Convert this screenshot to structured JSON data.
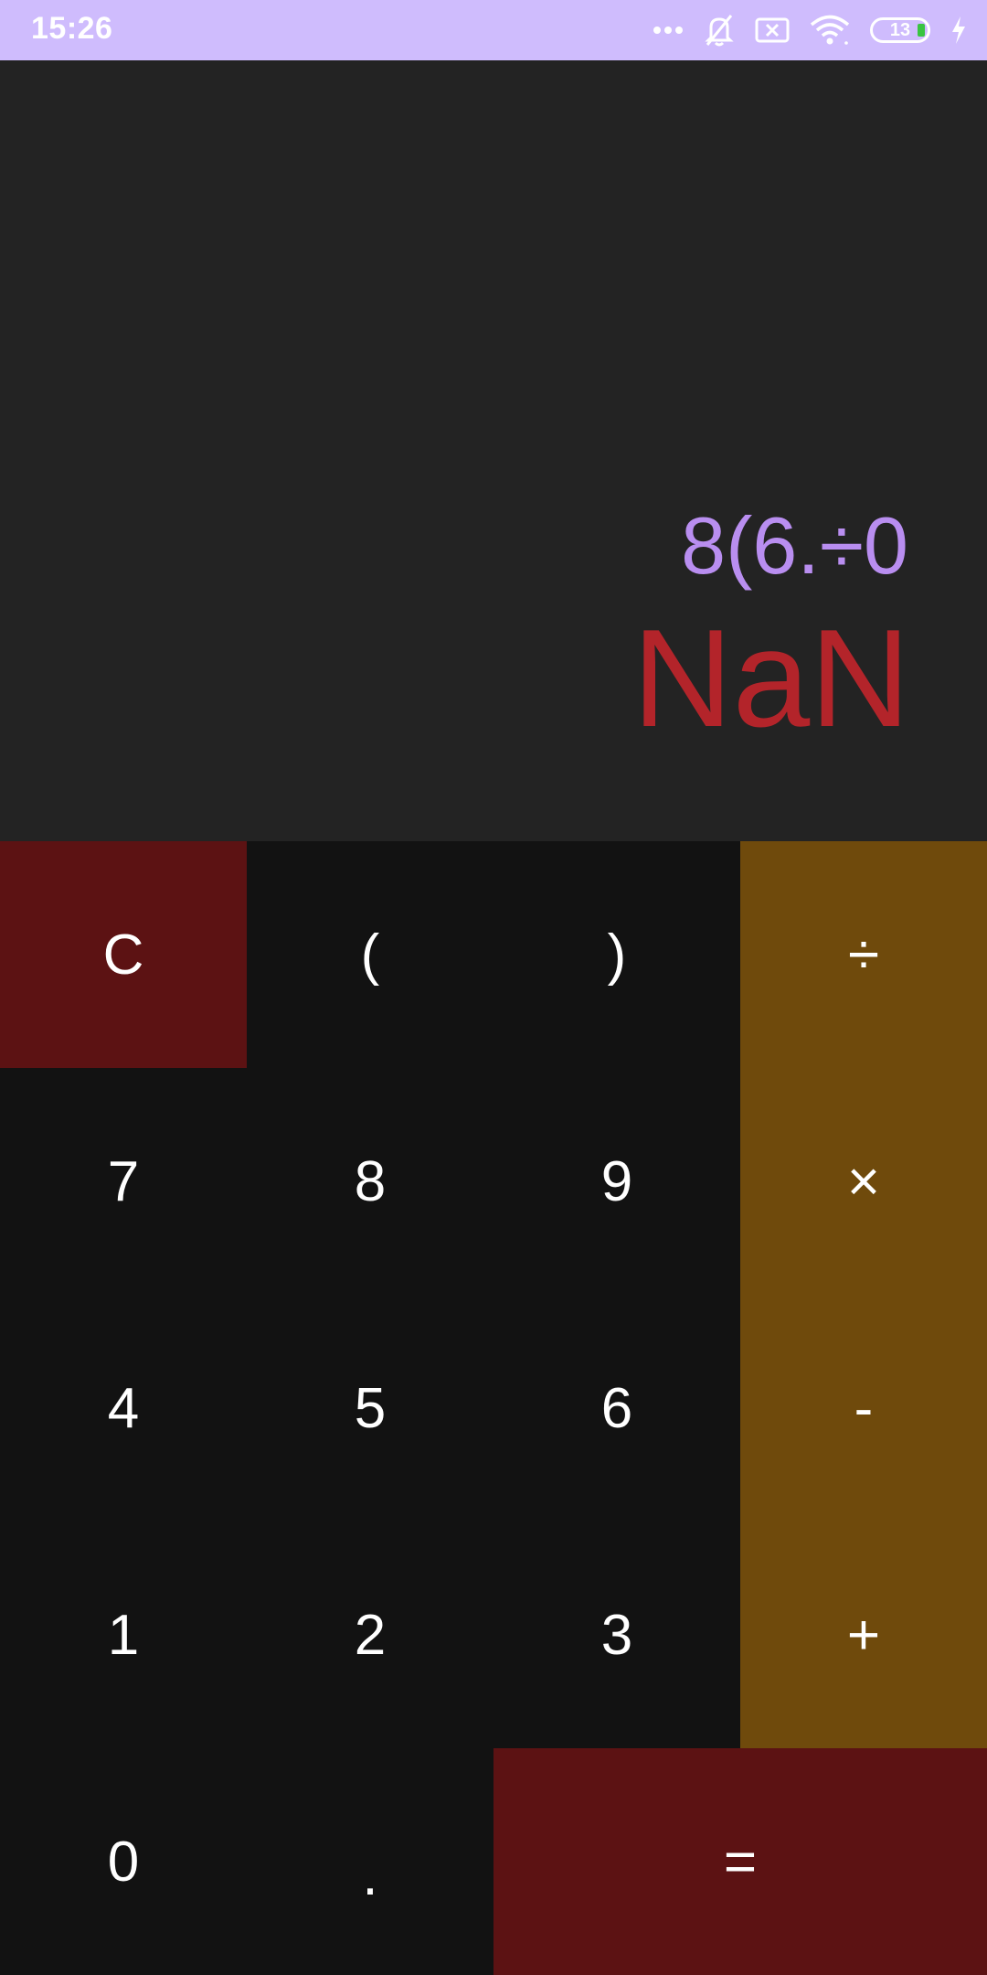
{
  "status_bar": {
    "time": "15:26",
    "battery": "13",
    "icons": [
      "more-dots-icon",
      "bell-off-icon",
      "sim-off-icon",
      "wifi-icon",
      "battery-icon",
      "charging-bolt-icon"
    ],
    "colors": {
      "background": "#cfbcfd"
    }
  },
  "display": {
    "expression": "8(6.÷0",
    "result": "NaN",
    "colors": {
      "expression": "#b98ef0",
      "result": "#b3242a",
      "background": "#232323"
    }
  },
  "keypad": {
    "clear": "C",
    "open_paren": "(",
    "close_paren": ")",
    "divide": "÷",
    "seven": "7",
    "eight": "8",
    "nine": "9",
    "multiply": "×",
    "four": "4",
    "five": "5",
    "six": "6",
    "subtract": "-",
    "one": "1",
    "two": "2",
    "three": "3",
    "add": "+",
    "zero": "0",
    "decimal": ".",
    "equals": "=",
    "colors": {
      "clear": "#5c1213",
      "operator": "#6f4a0c",
      "equals": "#5c1213",
      "digits": "#121212"
    }
  }
}
